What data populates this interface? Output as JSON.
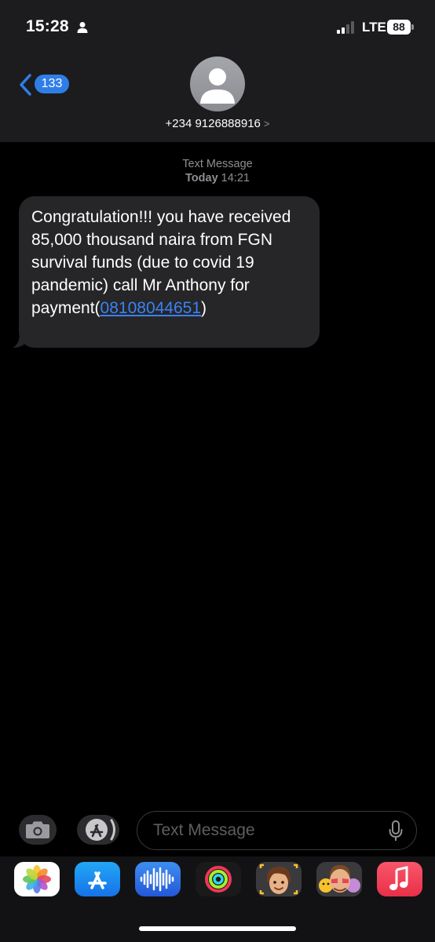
{
  "status_bar": {
    "time": "15:28",
    "network": "LTE",
    "battery": "88"
  },
  "header": {
    "back_count": "133",
    "contact_number": "+234 9126888916",
    "contact_chevron": ">"
  },
  "conversation": {
    "meta_type": "Text Message",
    "meta_day": "Today",
    "meta_time": "14:21",
    "message": {
      "text_before_link": "Congratulation!!!  you have received 85,000 thousand naira from FGN survival funds (due to covid 19 pandemic) call Mr Anthony for payment(",
      "link": "08108044651",
      "text_after_link": ")"
    }
  },
  "input_bar": {
    "placeholder": "Text Message"
  },
  "app_drawer": {
    "apps": [
      "photos-icon",
      "app-store-icon",
      "audio-message-icon",
      "fitness-icon",
      "memoji-icon",
      "memoji-stickers-icon",
      "music-icon"
    ]
  },
  "colors": {
    "accent": "#2f7ee8",
    "link": "#3b82f6",
    "bubble": "#262628",
    "header": "#1c1c1e",
    "music_red": "#f0475b"
  }
}
